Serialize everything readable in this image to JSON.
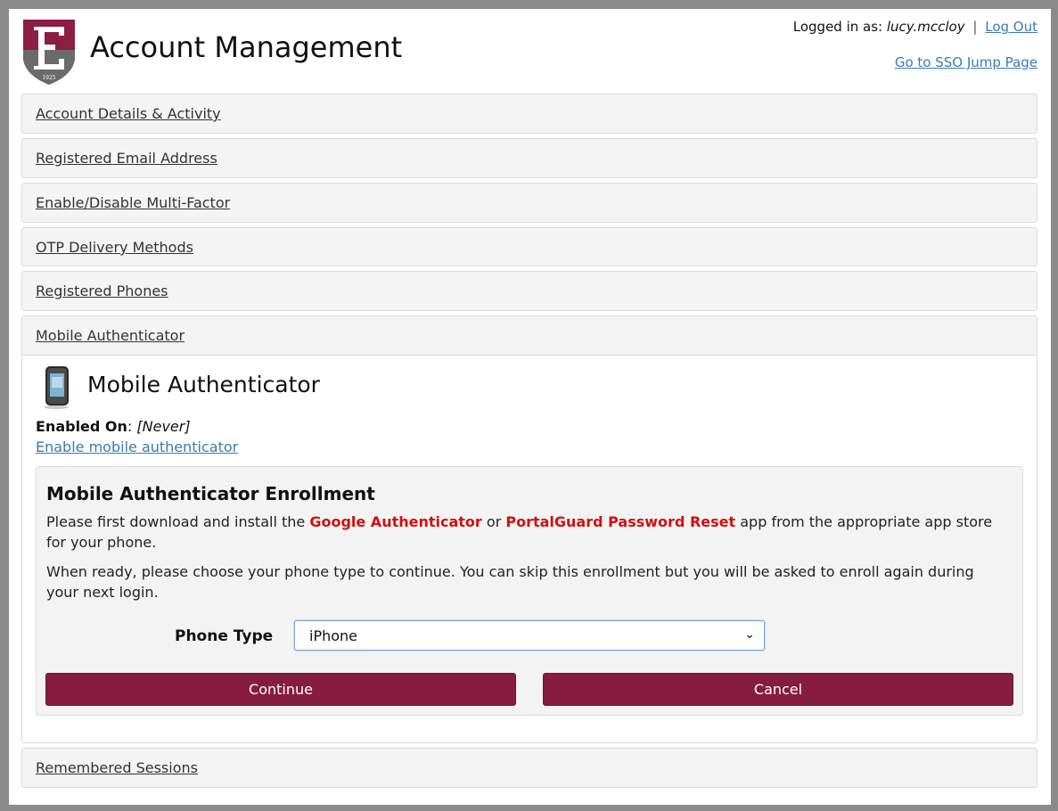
{
  "header": {
    "title": "Account Management",
    "logged_in_prefix": "Logged in as:",
    "username": "lucy.mccloy",
    "separator": "|",
    "logout_label": "Log Out",
    "sso_link_label": "Go to SSO Jump Page",
    "logo_year": "1925"
  },
  "accordion": {
    "items": [
      {
        "label": "Account Details & Activity"
      },
      {
        "label": "Registered Email Address"
      },
      {
        "label": "Enable/Disable Multi-Factor"
      },
      {
        "label": "OTP Delivery Methods"
      },
      {
        "label": "Registered Phones"
      },
      {
        "label": "Mobile Authenticator"
      },
      {
        "label": "Remembered Sessions"
      }
    ]
  },
  "mobile": {
    "section_title": "Mobile Authenticator",
    "enabled_on_label": "Enabled On",
    "enabled_on_value": "[Never]",
    "enable_link": "Enable mobile authenticator"
  },
  "enrollment": {
    "title": "Mobile Authenticator Enrollment",
    "p1_a": "Please first download and install the ",
    "p1_app1": "Google Authenticator",
    "p1_or": " or ",
    "p1_app2": "PortalGuard Password Reset",
    "p1_b": " app from the appropriate app store for your phone.",
    "p2": "When ready, please choose your phone type to continue. You can skip this enrollment but you will be asked to enroll again during your next login.",
    "phone_type_label": "Phone Type",
    "phone_type_value": "iPhone",
    "continue_label": "Continue",
    "cancel_label": "Cancel"
  },
  "colors": {
    "brand": "#861c3f",
    "link": "#3a7bb3",
    "highlight": "#d01010"
  }
}
